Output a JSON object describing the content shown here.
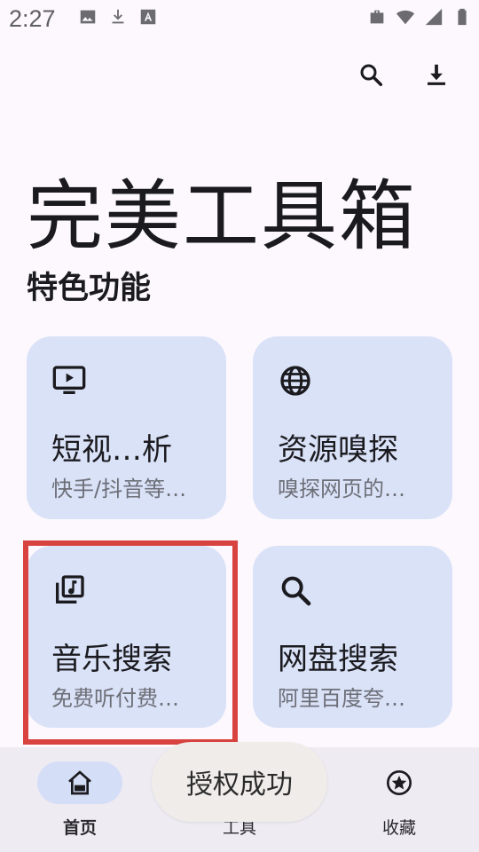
{
  "status_bar": {
    "time": "2:27"
  },
  "top_actions": {
    "search_icon": "search-icon",
    "download_icon": "download-icon"
  },
  "app_title": "完美工具箱",
  "section_title": "特色功能",
  "cards": [
    {
      "title": "短视…析",
      "desc": "快手/抖音等…",
      "icon": "tv-icon"
    },
    {
      "title": "资源嗅探",
      "desc": "嗅探网页的…",
      "icon": "globe-icon"
    },
    {
      "title": "音乐搜索",
      "desc": "免费听付费…",
      "icon": "music-library-icon"
    },
    {
      "title": "网盘搜索",
      "desc": "阿里百度夸…",
      "icon": "search-icon"
    }
  ],
  "bottom_nav": {
    "items": [
      {
        "label": "首页",
        "icon": "home-icon",
        "active": true
      },
      {
        "label": "工具",
        "icon": "tools-icon",
        "active": false
      },
      {
        "label": "收藏",
        "icon": "star-badge-icon",
        "active": false
      }
    ]
  },
  "toast": "授权成功",
  "colors": {
    "background": "#fcf8fd",
    "card": "#dae2f8",
    "highlight": "#d9433f",
    "nav_bar": "#eeebf3",
    "nav_active_pill": "#d5def7"
  }
}
